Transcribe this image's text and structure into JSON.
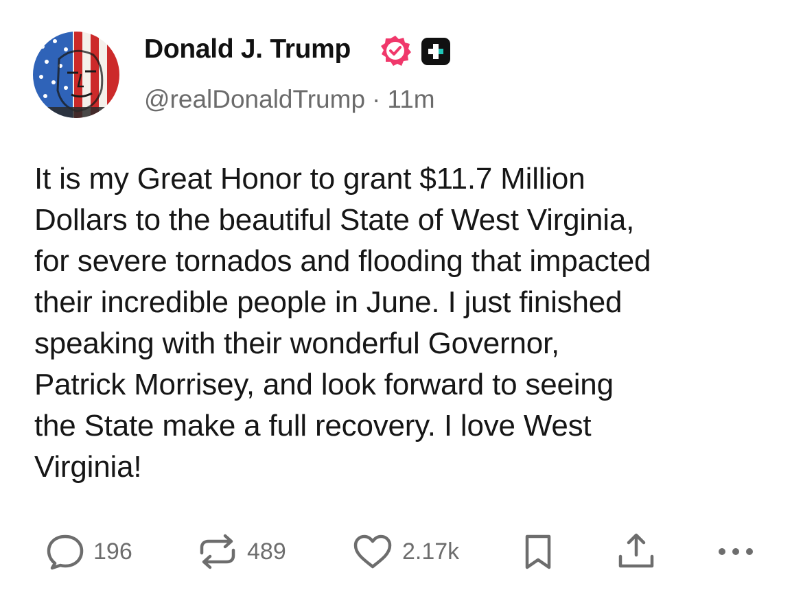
{
  "author": {
    "display_name": "Donald J. Trump",
    "handle": "@realDonaldTrump",
    "separator": "·",
    "time_ago": "11m",
    "avatar_icon": "flag-painted-portrait-avatar",
    "verified_icon": "verified-badge-icon",
    "verified_color": "#f0386b",
    "plus_icon": "truth-plus-icon"
  },
  "post": {
    "body": "It is my Great Honor to grant $11.7 Million\nDollars to the beautiful State of West Virginia,\nfor severe tornados and flooding that impacted\ntheir incredible people in June. I just finished\nspeaking with their wonderful Governor,\nPatrick Morrisey, and look forward to seeing\nthe State make a full recovery. I love West\nVirginia!"
  },
  "actions": {
    "reply": {
      "icon": "reply-bubble-icon",
      "count": "196"
    },
    "retruth": {
      "icon": "retruth-icon",
      "count": "489"
    },
    "like": {
      "icon": "heart-icon",
      "count": "2.17k"
    },
    "bookmark": {
      "icon": "bookmark-icon"
    },
    "share": {
      "icon": "share-upload-icon"
    },
    "more": {
      "icon": "more-dots-icon"
    }
  },
  "colors": {
    "text": "#161616",
    "muted": "#6b6b6b",
    "icon": "#6d6d6d",
    "accent_badge": "#f0386b"
  }
}
